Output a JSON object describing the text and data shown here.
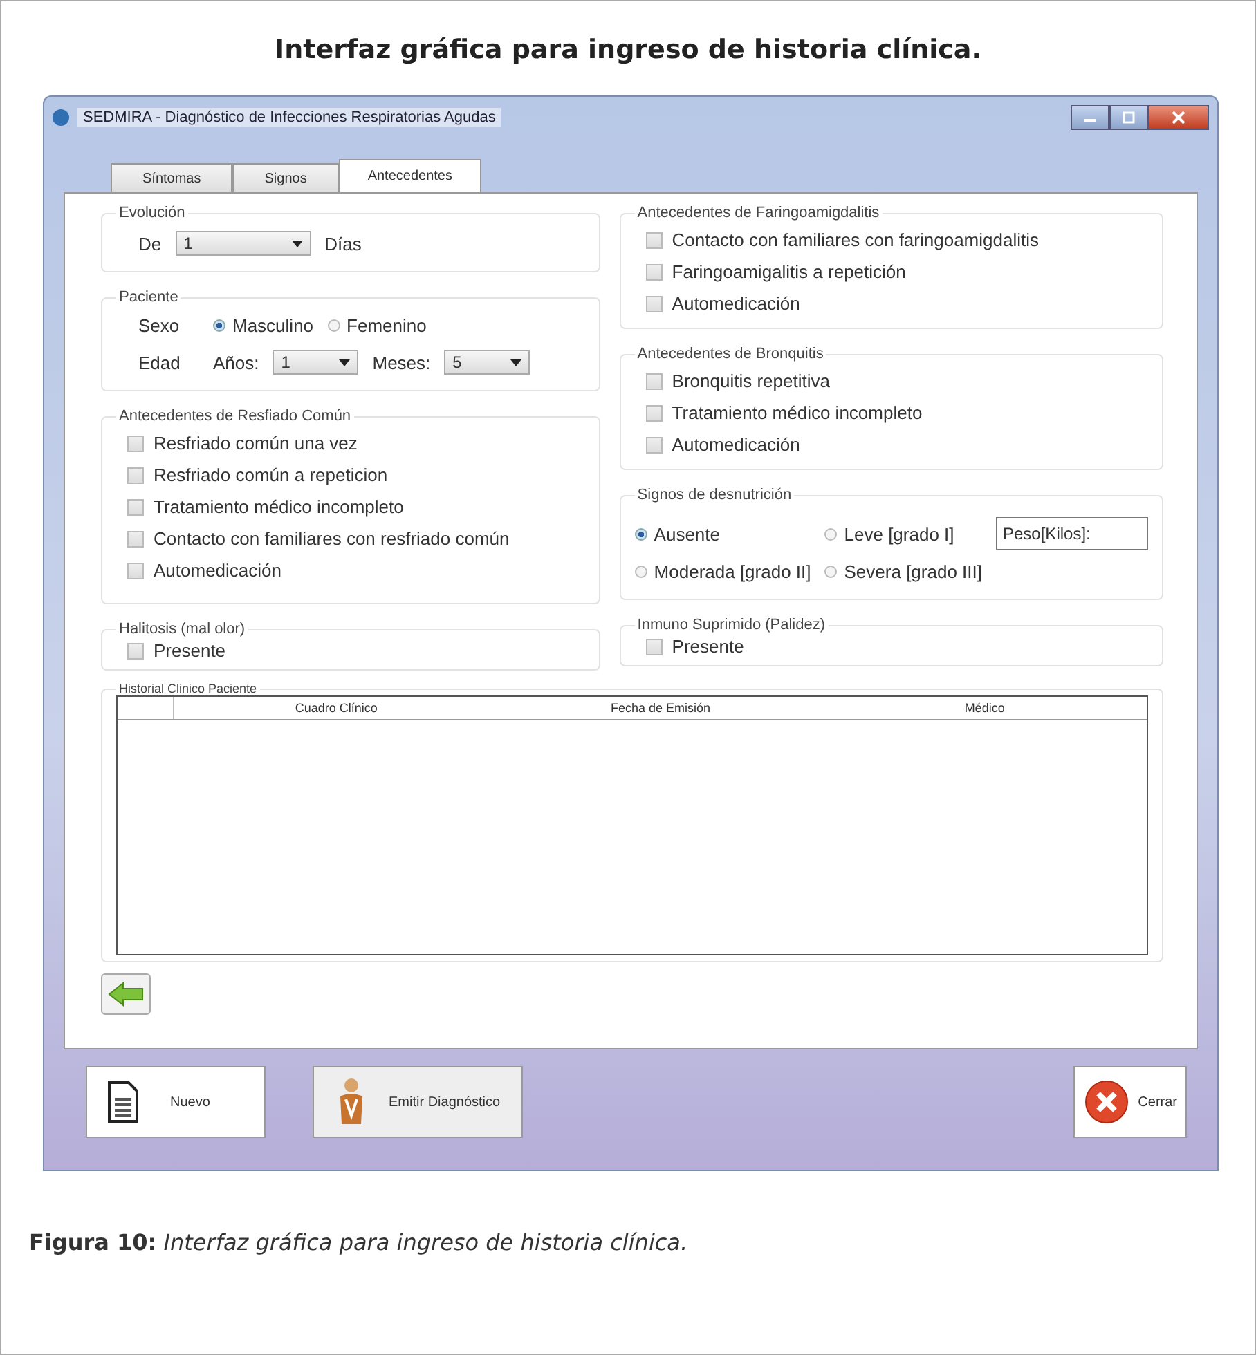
{
  "figure": {
    "title": "Interfaz gráfica para ingreso de historia clínica.",
    "caption_label": "Figura 10:",
    "caption_text": "Interfaz gráfica para ingreso de historia clínica."
  },
  "window": {
    "title": "SEDMIRA - Diagnóstico de Infecciones Respiratorias Agudas"
  },
  "tabs": [
    {
      "label": "Síntomas",
      "selected": false
    },
    {
      "label": "Signos",
      "selected": false
    },
    {
      "label": "Antecedentes",
      "selected": true
    }
  ],
  "evolucion": {
    "title": "Evolución",
    "label": "De",
    "value": "1",
    "unit": "Días"
  },
  "paciente": {
    "title": "Paciente",
    "sexo_label": "Sexo",
    "sexo_options": [
      {
        "label": "Masculino",
        "selected": true
      },
      {
        "label": "Femenino",
        "selected": false
      }
    ],
    "edad_label": "Edad",
    "anios_label": "Años:",
    "anios_value": "1",
    "meses_label": "Meses:",
    "meses_value": "5"
  },
  "resfriado": {
    "title": "Antecedentes de Resfiado Común",
    "items": [
      {
        "label": "Resfriado común una vez",
        "checked": false
      },
      {
        "label": "Resfriado común a repeticion",
        "checked": false
      },
      {
        "label": "Tratamiento médico incompleto",
        "checked": false
      },
      {
        "label": "Contacto con familiares con resfriado común",
        "checked": false
      },
      {
        "label": "Automedicación",
        "checked": false
      }
    ]
  },
  "faringo": {
    "title": "Antecedentes de Faringoamigdalitis",
    "items": [
      {
        "label": "Contacto con familiares con faringoamigdalitis",
        "checked": false
      },
      {
        "label": "Faringoamigalitis a repetición",
        "checked": false
      },
      {
        "label": "Automedicación",
        "checked": false
      }
    ]
  },
  "bronquitis": {
    "title": "Antecedentes de Bronquitis",
    "items": [
      {
        "label": "Bronquitis repetitiva",
        "checked": false
      },
      {
        "label": "Tratamiento médico incompleto",
        "checked": false
      },
      {
        "label": "Automedicación",
        "checked": false
      }
    ]
  },
  "desnutricion": {
    "title": "Signos de desnutrición",
    "options": [
      {
        "label": "Ausente",
        "selected": true
      },
      {
        "label": "Leve [grado I]",
        "selected": false
      },
      {
        "label": "Moderada [grado II]",
        "selected": false
      },
      {
        "label": "Severa [grado III]",
        "selected": false
      }
    ],
    "peso_label": "Peso[Kilos]:"
  },
  "halitosis": {
    "title": "Halitosis (mal olor)",
    "items": [
      {
        "label": "Presente",
        "checked": false
      }
    ]
  },
  "inmuno": {
    "title": "Inmuno Suprimido (Palidez)",
    "items": [
      {
        "label": "Presente",
        "checked": false
      }
    ]
  },
  "historial": {
    "title": "Historial Clinico Paciente",
    "columns": [
      "Cuadro Clínico",
      "Fecha de Emisión",
      "Médico"
    ]
  },
  "buttons": [
    {
      "label": "Nuevo",
      "kind": "new"
    },
    {
      "label": "Emitir Diagnóstico",
      "kind": "diagnose"
    },
    {
      "label": "Cerrar",
      "kind": "close"
    }
  ]
}
